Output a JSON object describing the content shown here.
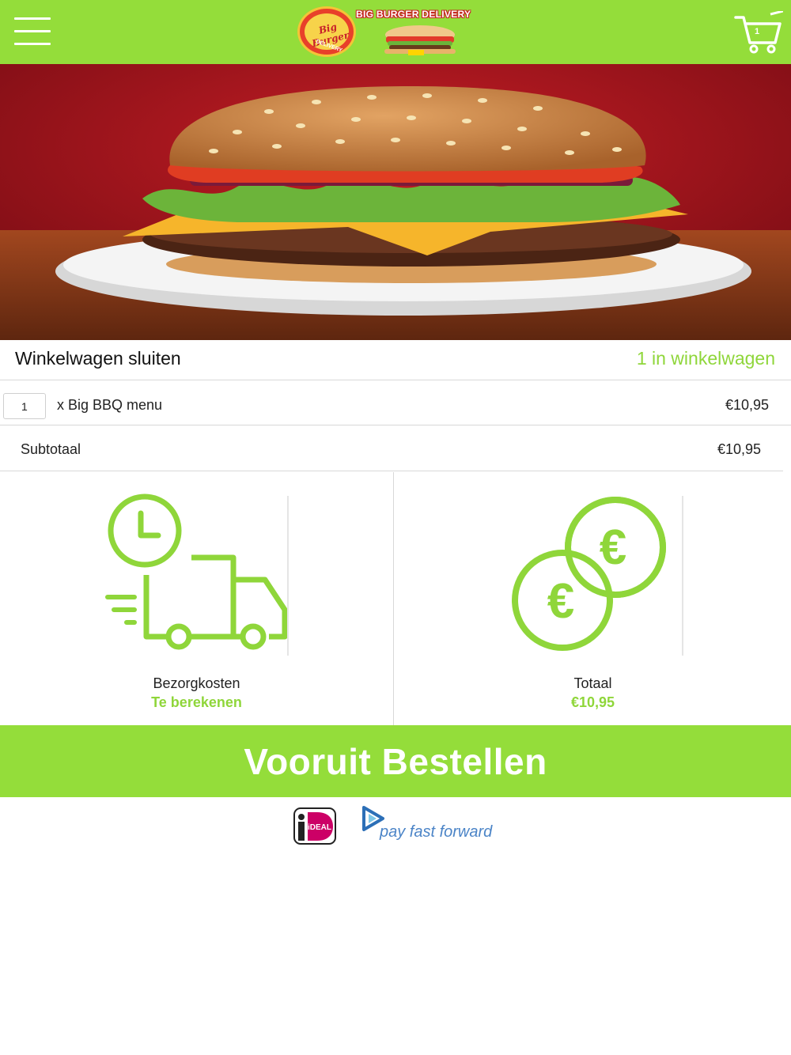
{
  "header": {
    "logo_badge_text": "Big Burger",
    "logo_badge_sub": "DELIVERY",
    "logo_title": "BIG BURGER DELIVERY",
    "cart_count": "1",
    "menu_icon": "hamburger-menu-icon",
    "cart_icon": "shopping-cart-icon"
  },
  "cart": {
    "close_label": "Winkelwagen sluiten",
    "status": "1 in winkelwagen",
    "items": [
      {
        "qty": "1",
        "name": "x Big BBQ menu",
        "price": "€10,95"
      }
    ],
    "subtotal_label": "Subtotaal",
    "subtotal_value": "€10,95"
  },
  "summary": {
    "delivery_label": "Bezorgkosten",
    "delivery_value": "Te berekenen",
    "delivery_icon": "delivery-truck-clock-icon",
    "total_label": "Totaal",
    "total_value": "€10,95",
    "total_icon": "euro-coins-icon"
  },
  "order_button": "Vooruit Bestellen",
  "payment": {
    "ideal_text": "iDEAL",
    "payff_text": "pay fast forward"
  },
  "colors": {
    "brand_green": "#94dd3a",
    "accent_green": "#8fd63a"
  }
}
